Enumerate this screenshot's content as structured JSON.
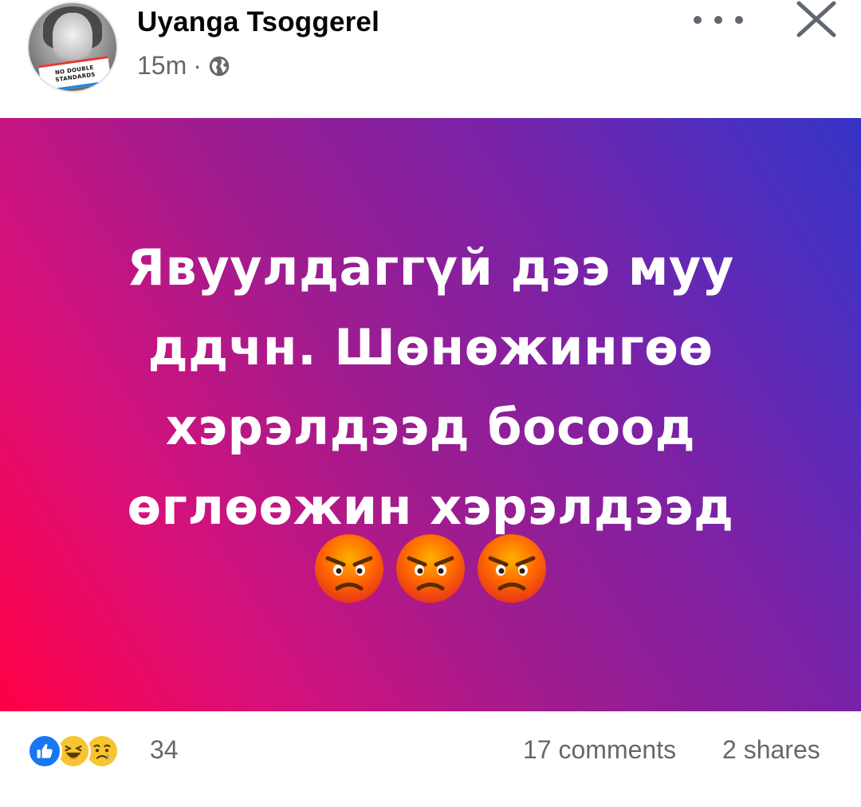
{
  "post": {
    "author": "Uyanga Tsoggerel",
    "time": "15m",
    "separator": "·",
    "privacy_icon": "globe-icon",
    "avatar_banner_line1": "NO DOUBLE",
    "avatar_banner_line2": "STANDARDS",
    "text_lines": [
      "Явуулдаггүй дээ муу",
      "ддчн. Шөнөжингөө",
      "хэрэлдээд босоод",
      "өглөөжин хэрэлдээд"
    ],
    "emojis": [
      "angry-face-icon",
      "angry-face-icon",
      "angry-face-icon"
    ],
    "background_colors": [
      "#ff0045",
      "#a01c8e",
      "#3533c4"
    ]
  },
  "header_actions": {
    "more_icon": "more-horizontal-icon",
    "close_icon": "close-icon"
  },
  "footer": {
    "reaction_icons": [
      "like-icon",
      "haha-icon",
      "sad-icon"
    ],
    "reaction_count": "34",
    "comments": "17 comments",
    "shares": "2 shares"
  }
}
